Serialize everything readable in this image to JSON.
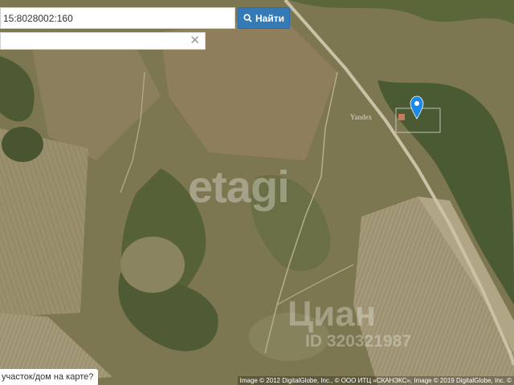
{
  "search": {
    "input_value": "15:8028002:160",
    "button_label": "Найти",
    "button_icon": "search-icon"
  },
  "result_box": {
    "clear_icon": "close-icon",
    "clear_glyph": "✕"
  },
  "map": {
    "imagery_label": "Yandex",
    "watermark_main": "etagi",
    "watermark_secondary": "Циан",
    "watermark_id": "ID 320321987",
    "attribution": "Image © 2012 DigitalGlobe, Inc., © ООО ИТЦ «СКАНЭКС», Image © 2019 DigitalGlobe, Inc. ©",
    "marker_icon": "map-pin-icon",
    "marker_color": "#1e88e5"
  },
  "bottom_link": {
    "label": "участок/дом на карте?"
  },
  "colors": {
    "accent": "#337ab7"
  }
}
